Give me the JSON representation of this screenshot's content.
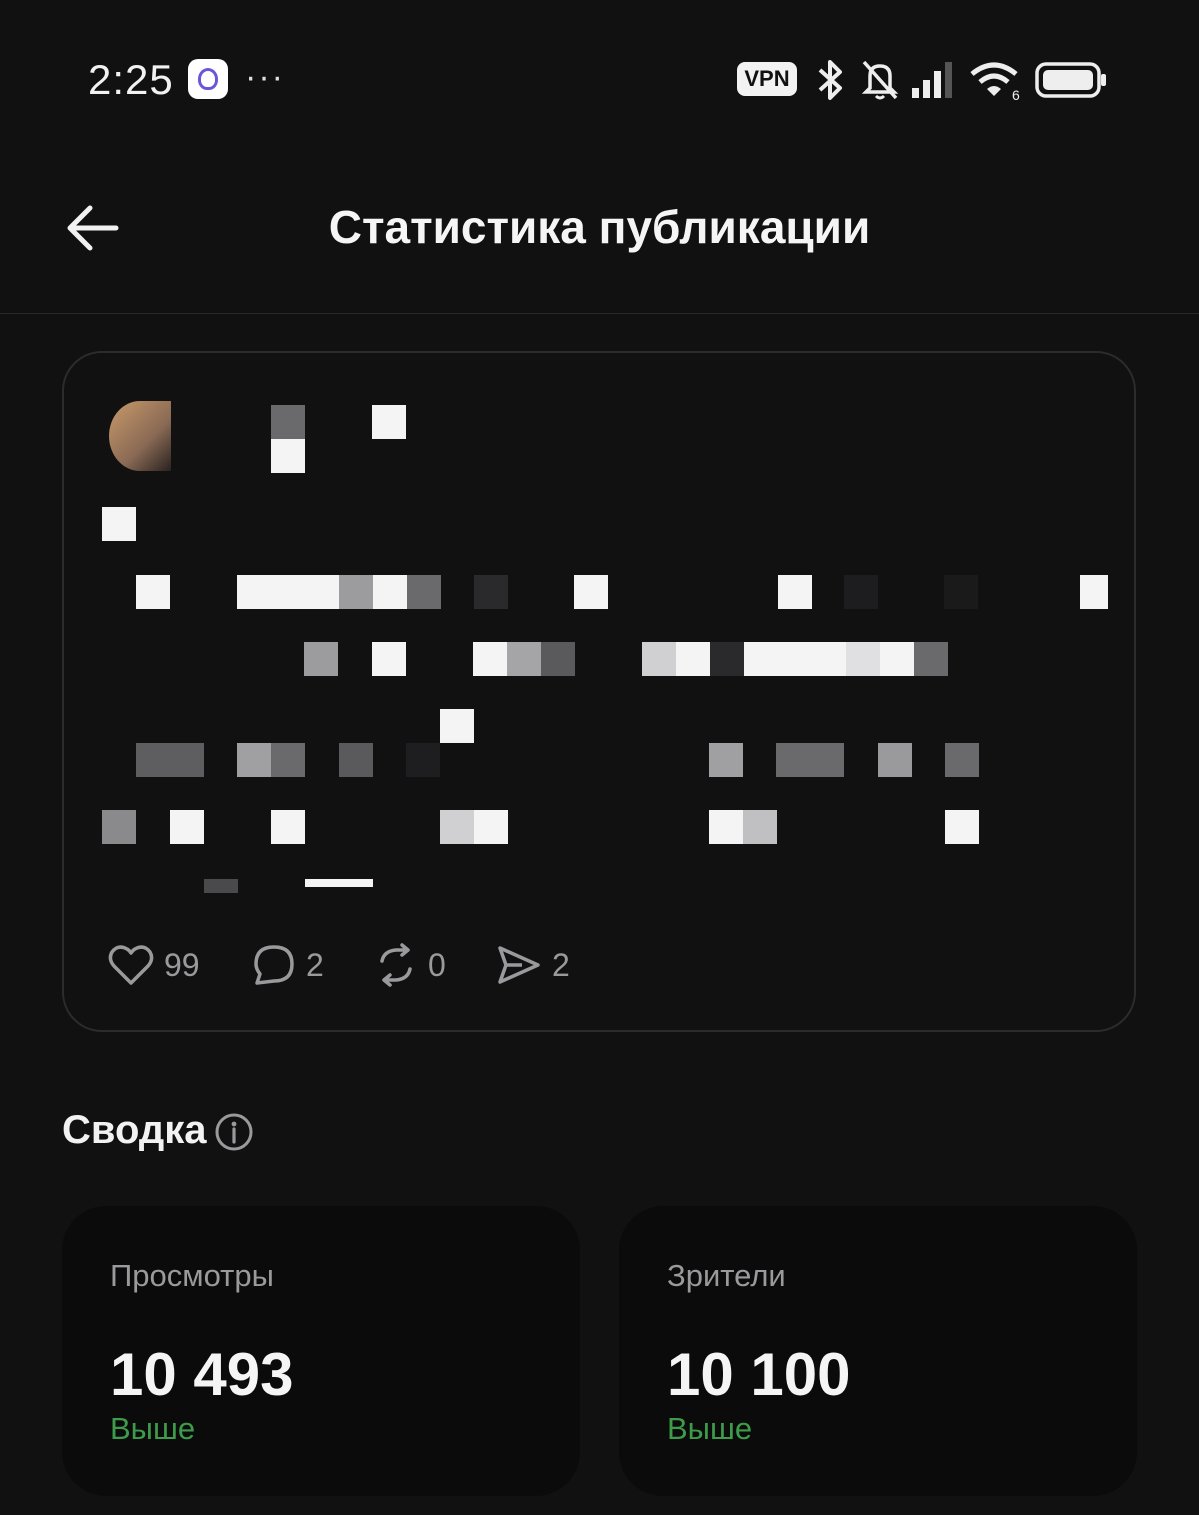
{
  "status_bar": {
    "time": "2:25",
    "vpn_label": "VPN",
    "icons": [
      "alice-icon",
      "more-dots-icon",
      "bluetooth-icon",
      "bell-off-icon",
      "signal-icon",
      "wifi-icon",
      "battery-icon"
    ]
  },
  "header": {
    "title": "Статистика публикации"
  },
  "post": {
    "actions": [
      {
        "icon": "heart-icon",
        "count": "99"
      },
      {
        "icon": "comment-icon",
        "count": "2"
      },
      {
        "icon": "repost-icon",
        "count": "0"
      },
      {
        "icon": "send-icon",
        "count": "2"
      }
    ]
  },
  "summary": {
    "title": "Сводка",
    "cards": [
      {
        "label": "Просмотры",
        "value": "10 493",
        "trend": "Выше"
      },
      {
        "label": "Зрители",
        "value": "10 100",
        "trend": "Выше"
      }
    ]
  },
  "colors": {
    "background": "#111112",
    "card_border": "#2c2c2e",
    "stat_bg": "#0b0b0c",
    "trend_green": "#3d9b4a"
  }
}
